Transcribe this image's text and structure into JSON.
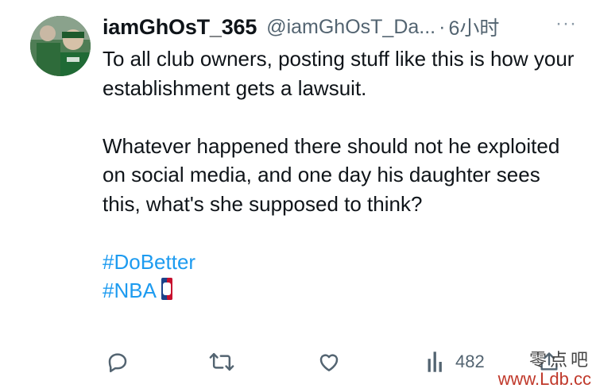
{
  "tweet": {
    "display_name": "iamGhOsT_365",
    "handle": "@iamGhOsT_Da...",
    "separator": "·",
    "time": "6小时",
    "more": "···",
    "paragraph1": "To all club owners, posting stuff like this is how your establishment gets a lawsuit.",
    "paragraph2": "Whatever happened there should not he exploited on social media, and one day his daughter sees this, what's she supposed to think?",
    "hashtag1": "#DoBetter",
    "hashtag2": "#NBA"
  },
  "actions": {
    "reply_icon": "reply-icon",
    "retweet_icon": "retweet-icon",
    "like_icon": "heart-icon",
    "views_icon": "views-icon",
    "views_count": "482",
    "share_icon": "share-icon"
  },
  "colors": {
    "text": "#0f1419",
    "muted": "#536471",
    "link": "#1d9bf0",
    "background": "#ffffff"
  },
  "watermark": {
    "chinese": "零点吧",
    "url": "www.Ldb.cc"
  }
}
